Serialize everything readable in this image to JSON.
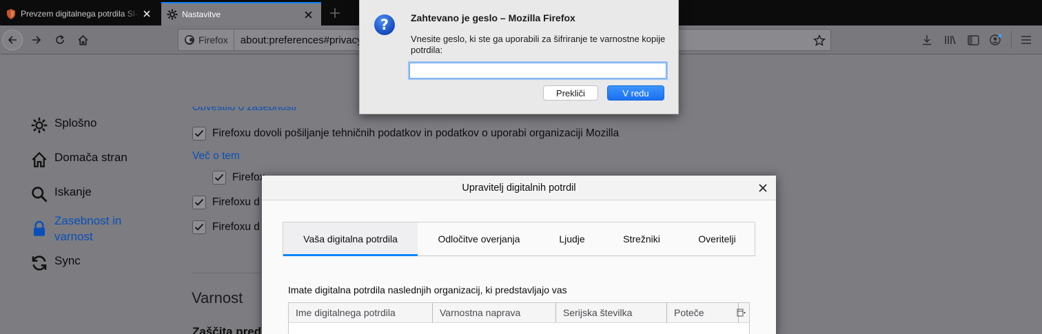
{
  "tabs": [
    {
      "title": "Prevzem digitalnega potrdila SI-TRUST",
      "active": false
    },
    {
      "title": "Nastavitve",
      "active": true
    }
  ],
  "urlbar": {
    "identity": "Firefox",
    "url": "about:preferences#privacy"
  },
  "sidebar": {
    "items": [
      {
        "label": "Splošno",
        "icon": "gear-icon"
      },
      {
        "label": "Domača stran",
        "icon": "home-icon"
      },
      {
        "label": "Iskanje",
        "icon": "search-icon"
      },
      {
        "label": "Zasebnost in varnost",
        "icon": "lock-icon",
        "selected": true
      },
      {
        "label": "Sync",
        "icon": "sync-icon"
      }
    ]
  },
  "prefs": {
    "cutoff_heading": "Obvestilo o zasebnosti",
    "telemetry_label": "Firefoxu dovoli pošiljanje tehničnih podatkov in podatkov o uporabi organizaciji Mozilla",
    "learn_more": "Več o tem",
    "row2_label": "Firefox",
    "row3_label": "Firefoxu d",
    "row4_label": "Firefoxu d",
    "security_heading": "Varnost",
    "security_sub": "Zaščita pred"
  },
  "cert_manager": {
    "title": "Upravitelj digitalnih potrdil",
    "tabs": [
      "Vaša digitalna potrdila",
      "Odločitve overjanja",
      "Ljudje",
      "Strežniki",
      "Overitelji"
    ],
    "intro": "Imate digitalna potrdila naslednjih organizacij, ki predstavljajo vas",
    "columns": [
      "Ime digitalnega potrdila",
      "Varnostna naprava",
      "Serijska številka",
      "Poteče"
    ]
  },
  "password_prompt": {
    "title": "Zahtevano je geslo – Mozilla Firefox",
    "message": "Vnesite geslo, ki ste ga uporabili za šifriranje te varnostne kopije potrdila:",
    "input_value": "",
    "cancel_label": "Prekliči",
    "ok_label": "V redu"
  },
  "colors": {
    "accent": "#0a84ff",
    "link": "#0a4fb8",
    "ok_button": "#1a6ff2"
  }
}
